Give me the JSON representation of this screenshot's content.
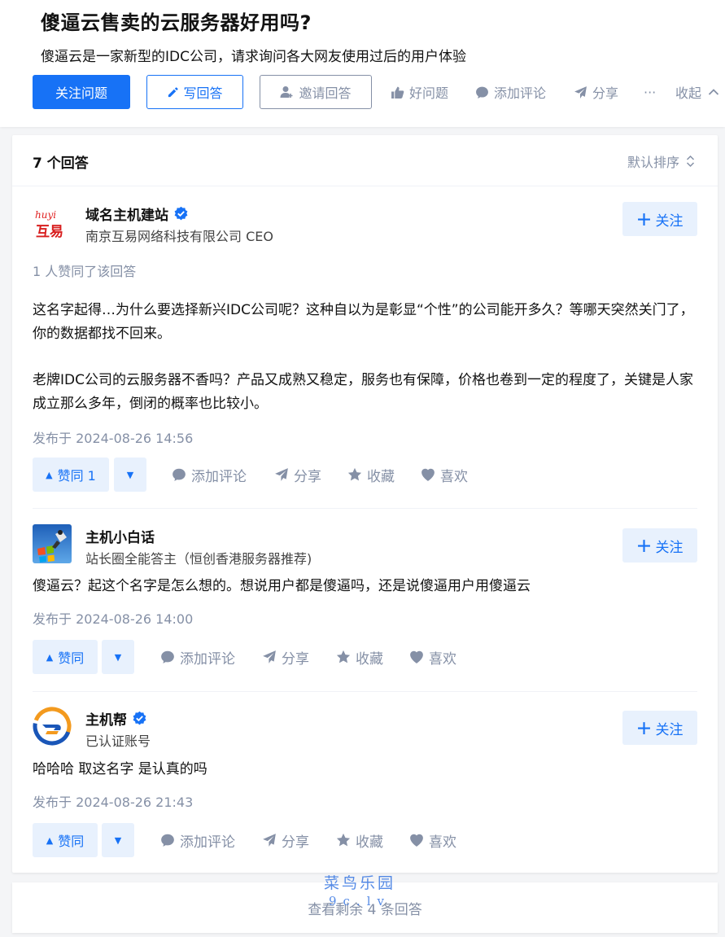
{
  "question": {
    "title": "傻逼云售卖的云服务器好用吗?",
    "description": "傻逼云是一家新型的IDC公司，请求询问各大网友使用过后的用户体验",
    "actions": {
      "follow_label": "关注问题",
      "write_label": "写回答",
      "invite_label": "邀请回答",
      "good_label": "好问题",
      "comment_label": "添加评论",
      "share_label": "分享",
      "more_label": "···",
      "collapse_label": "收起"
    }
  },
  "answers_header": {
    "count_label": "7 个回答",
    "sort_label": "默认排序"
  },
  "answers": [
    {
      "author": "域名主机建站",
      "verified": true,
      "bio": "南京互易网络科技有限公司 CEO",
      "follow_label": "关注",
      "upvote_info": "1 人赞同了该回答",
      "paragraphs": [
        "这名字起得…为什么要选择新兴IDC公司呢？这种自以为是彰显“个性”的公司能开多久？等哪天突然关门了，你的数据都找不回来。",
        "老牌IDC公司的云服务器不香吗？产品又成熟又稳定，服务也有保障，价格也卷到一定的程度了，关键是人家成立那么多年，倒闭的概率也比较小。"
      ],
      "time": "发布于 2024-08-26 14:56",
      "vote_label": "赞同 1",
      "comment_label": "添加评论",
      "share_label": "分享",
      "collect_label": "收藏",
      "like_label": "喜欢"
    },
    {
      "author": "主机小白话",
      "verified": false,
      "bio": "站长圈全能答主（恒创香港服务器推荐)",
      "follow_label": "关注",
      "paragraphs": [
        "傻逼云？起这个名字是怎么想的。想说用户都是傻逼吗，还是说傻逼用户用傻逼云"
      ],
      "time": "发布于 2024-08-26 14:00",
      "vote_label": "赞同",
      "comment_label": "添加评论",
      "share_label": "分享",
      "collect_label": "收藏",
      "like_label": "喜欢"
    },
    {
      "author": "主机帮",
      "verified": true,
      "bio": "已认证账号",
      "follow_label": "关注",
      "paragraphs": [
        "哈哈哈 取这名字 是认真的吗"
      ],
      "time": "发布于 2024-08-26 21:43",
      "vote_label": "赞同",
      "comment_label": "添加评论",
      "share_label": "分享",
      "collect_label": "收藏",
      "like_label": "喜欢"
    }
  ],
  "more_answers_label": "查看剩余 4 条回答",
  "avatar_text": {
    "huyi_top": "huyi",
    "huyi_main": "互易"
  },
  "watermark": {
    "line1": "菜鸟乐园",
    "line2": "9c.lv"
  },
  "colors": {
    "primary": "#1772f6",
    "primary_light": "#e8f1fd",
    "muted": "#8590a6",
    "text": "#121212",
    "verified": "#1772f6"
  }
}
